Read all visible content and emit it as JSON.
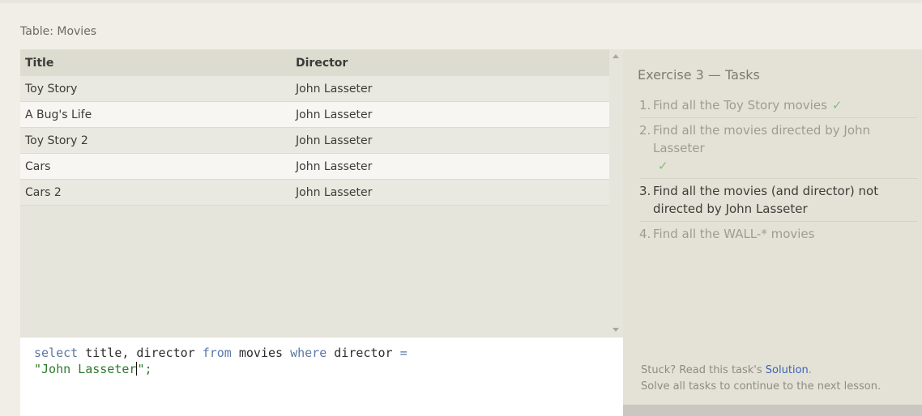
{
  "table": {
    "caption": "Table: Movies",
    "columns": [
      "Title",
      "Director"
    ],
    "rows": [
      [
        "Toy Story",
        "John Lasseter"
      ],
      [
        "A Bug's Life",
        "John Lasseter"
      ],
      [
        "Toy Story 2",
        "John Lasseter"
      ],
      [
        "Cars",
        "John Lasseter"
      ],
      [
        "Cars 2",
        "John Lasseter"
      ]
    ]
  },
  "editor": {
    "tokens": {
      "select": "select",
      "cols": " title, director ",
      "from": "from",
      "table": " movies ",
      "where": "where",
      "cond": " director ",
      "eq": "=",
      "value": "\"John Lasseter",
      "tail": "\";"
    }
  },
  "tasks": {
    "heading": "Exercise 3 — Tasks",
    "items": [
      {
        "num": "1.",
        "text": "Find all the Toy Story movies",
        "check": "✓"
      },
      {
        "num": "2.",
        "text": "Find all the movies directed by John Lasseter",
        "check": "✓"
      },
      {
        "num": "3.",
        "text": "Find all the movies (and director) not directed by John Lasseter",
        "check": ""
      },
      {
        "num": "4.",
        "text": "Find all the WALL-* movies",
        "check": ""
      }
    ]
  },
  "footer": {
    "stuck_prefix": "Stuck? Read this task's ",
    "solution_link": "Solution",
    "stuck_suffix": ".",
    "solve_all": "Solve all tasks to continue to the next lesson."
  },
  "colors": {
    "keyword": "#5b77a6",
    "string": "#2d7a2d",
    "check": "#7fbf7f",
    "link": "#3b63b8"
  }
}
